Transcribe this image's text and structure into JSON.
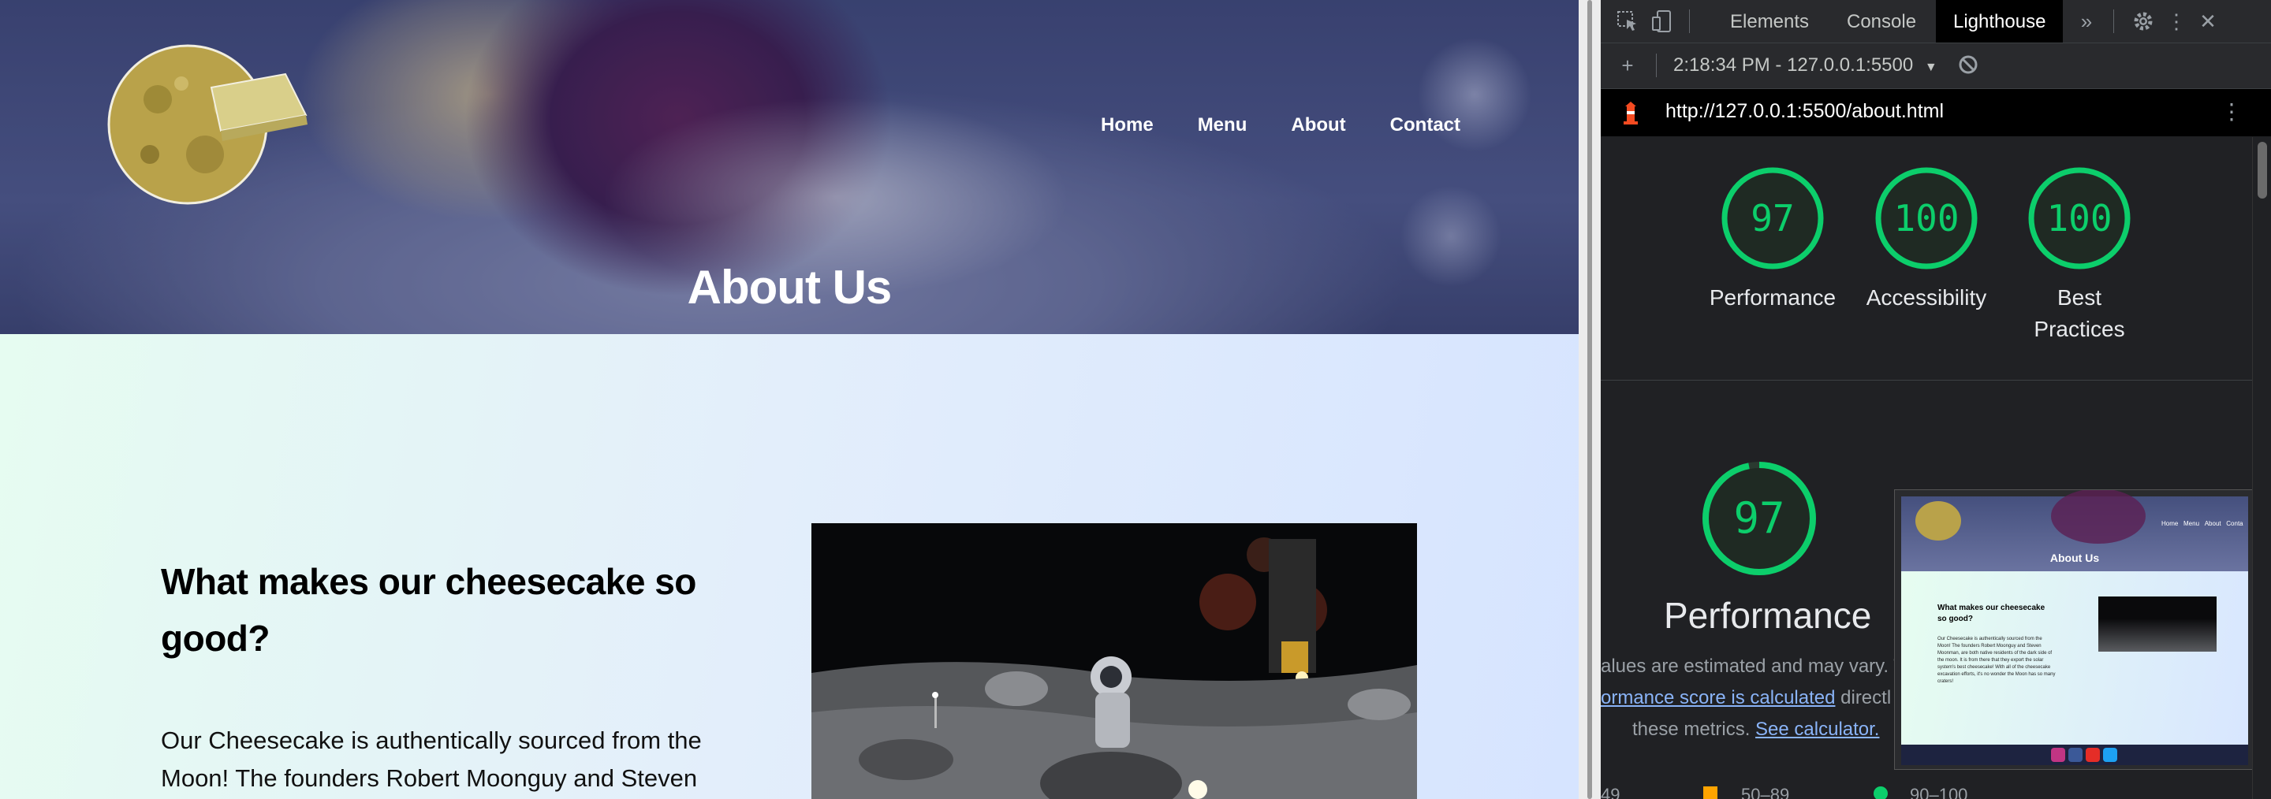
{
  "site": {
    "nav": [
      "Home",
      "Menu",
      "About",
      "Contact"
    ],
    "hero_title": "About Us",
    "section_heading": "What makes our cheesecake so good?",
    "section_text": "Our Cheesecake is authentically sourced from the Moon! The founders Robert Moonguy and Steven"
  },
  "devtools": {
    "tabs": [
      "Elements",
      "Console",
      "Lighthouse"
    ],
    "active_tab": "Lighthouse",
    "report_select": "2:18:34 PM - 127.0.0.1:5500",
    "url": "http://127.0.0.1:5500/about.html",
    "scores": [
      {
        "value": 97,
        "label": "Performance"
      },
      {
        "value": 100,
        "label": "Accessibility"
      },
      {
        "value": 100,
        "label": "Best Practices"
      }
    ],
    "performance": {
      "score": 97,
      "title": "Performance",
      "line1": "alues are estimated and may vary. T",
      "line2_link": "ormance score is calculated",
      "line2_rest": " directl",
      "line3": "these metrics. ",
      "line3_link": "See calculator."
    },
    "legend": [
      "49",
      "50–89",
      "90–100"
    ],
    "colors": {
      "pass": "#0cce6b",
      "average": "#ffa400",
      "link": "#8ab4f8"
    },
    "thumbnail": {
      "hero_title": "About Us",
      "nav": [
        "Home",
        "Menu",
        "About",
        "Conta"
      ],
      "heading": "What makes our cheesecake so good?",
      "text": "Our Cheesecake is authentically sourced from the Moon! The founders Robert Moonguy and Steven Moonman, are both native residents of the dark side of the moon. It is from there that they export the solar system's best cheesecake! With all of the cheesecake excavation efforts, it's no wonder the Moon has so many craters!"
    }
  }
}
